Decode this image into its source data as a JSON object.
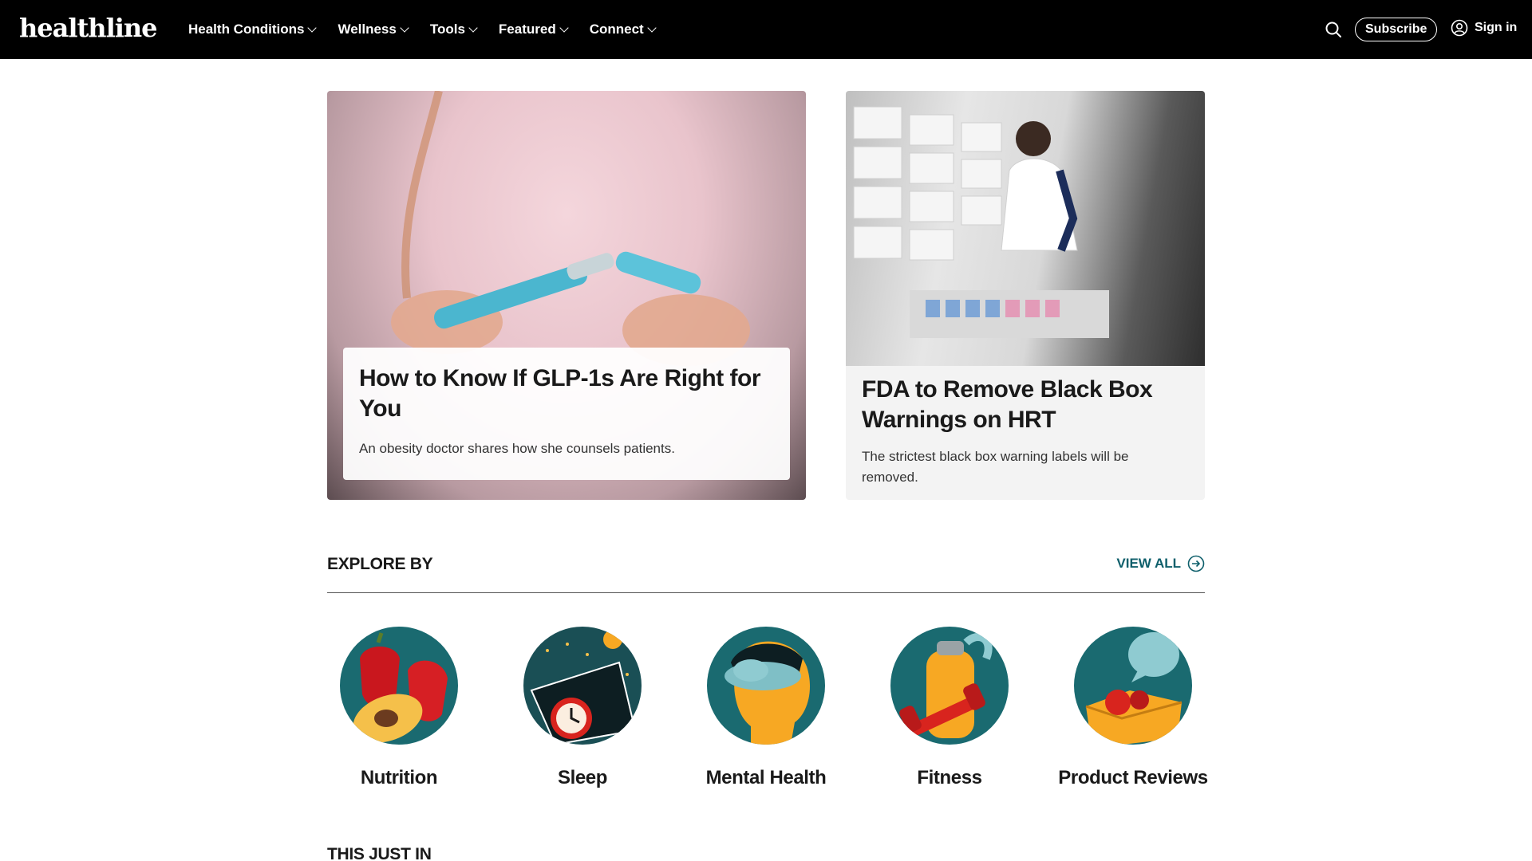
{
  "header": {
    "logo": "healthline",
    "nav": [
      {
        "label": "Health Conditions"
      },
      {
        "label": "Wellness"
      },
      {
        "label": "Tools"
      },
      {
        "label": "Featured"
      },
      {
        "label": "Connect"
      }
    ],
    "subscribe_label": "Subscribe",
    "signin_label": "Sign in"
  },
  "features": [
    {
      "title": "How to Know If GLP-1s Are Right for You",
      "desc": "An obesity doctor shares how she counsels patients."
    },
    {
      "title": "FDA to Remove Black Box Warnings on HRT",
      "desc": "The strictest black box warning labels will be removed."
    }
  ],
  "explore": {
    "title": "EXPLORE BY",
    "view_all": "VIEW ALL",
    "categories": [
      {
        "label": "Nutrition",
        "icon": "nutrition-icon"
      },
      {
        "label": "Sleep",
        "icon": "sleep-icon"
      },
      {
        "label": "Mental Health",
        "icon": "mental-health-icon"
      },
      {
        "label": "Fitness",
        "icon": "fitness-icon"
      },
      {
        "label": "Product Reviews",
        "icon": "product-reviews-icon"
      }
    ]
  },
  "just_in": "THIS JUST IN",
  "colors": {
    "header_bg": "#000000",
    "accent_teal": "#0e5f6b",
    "circle_teal": "#1a6a70",
    "card_bg": "#f3f3f3"
  }
}
